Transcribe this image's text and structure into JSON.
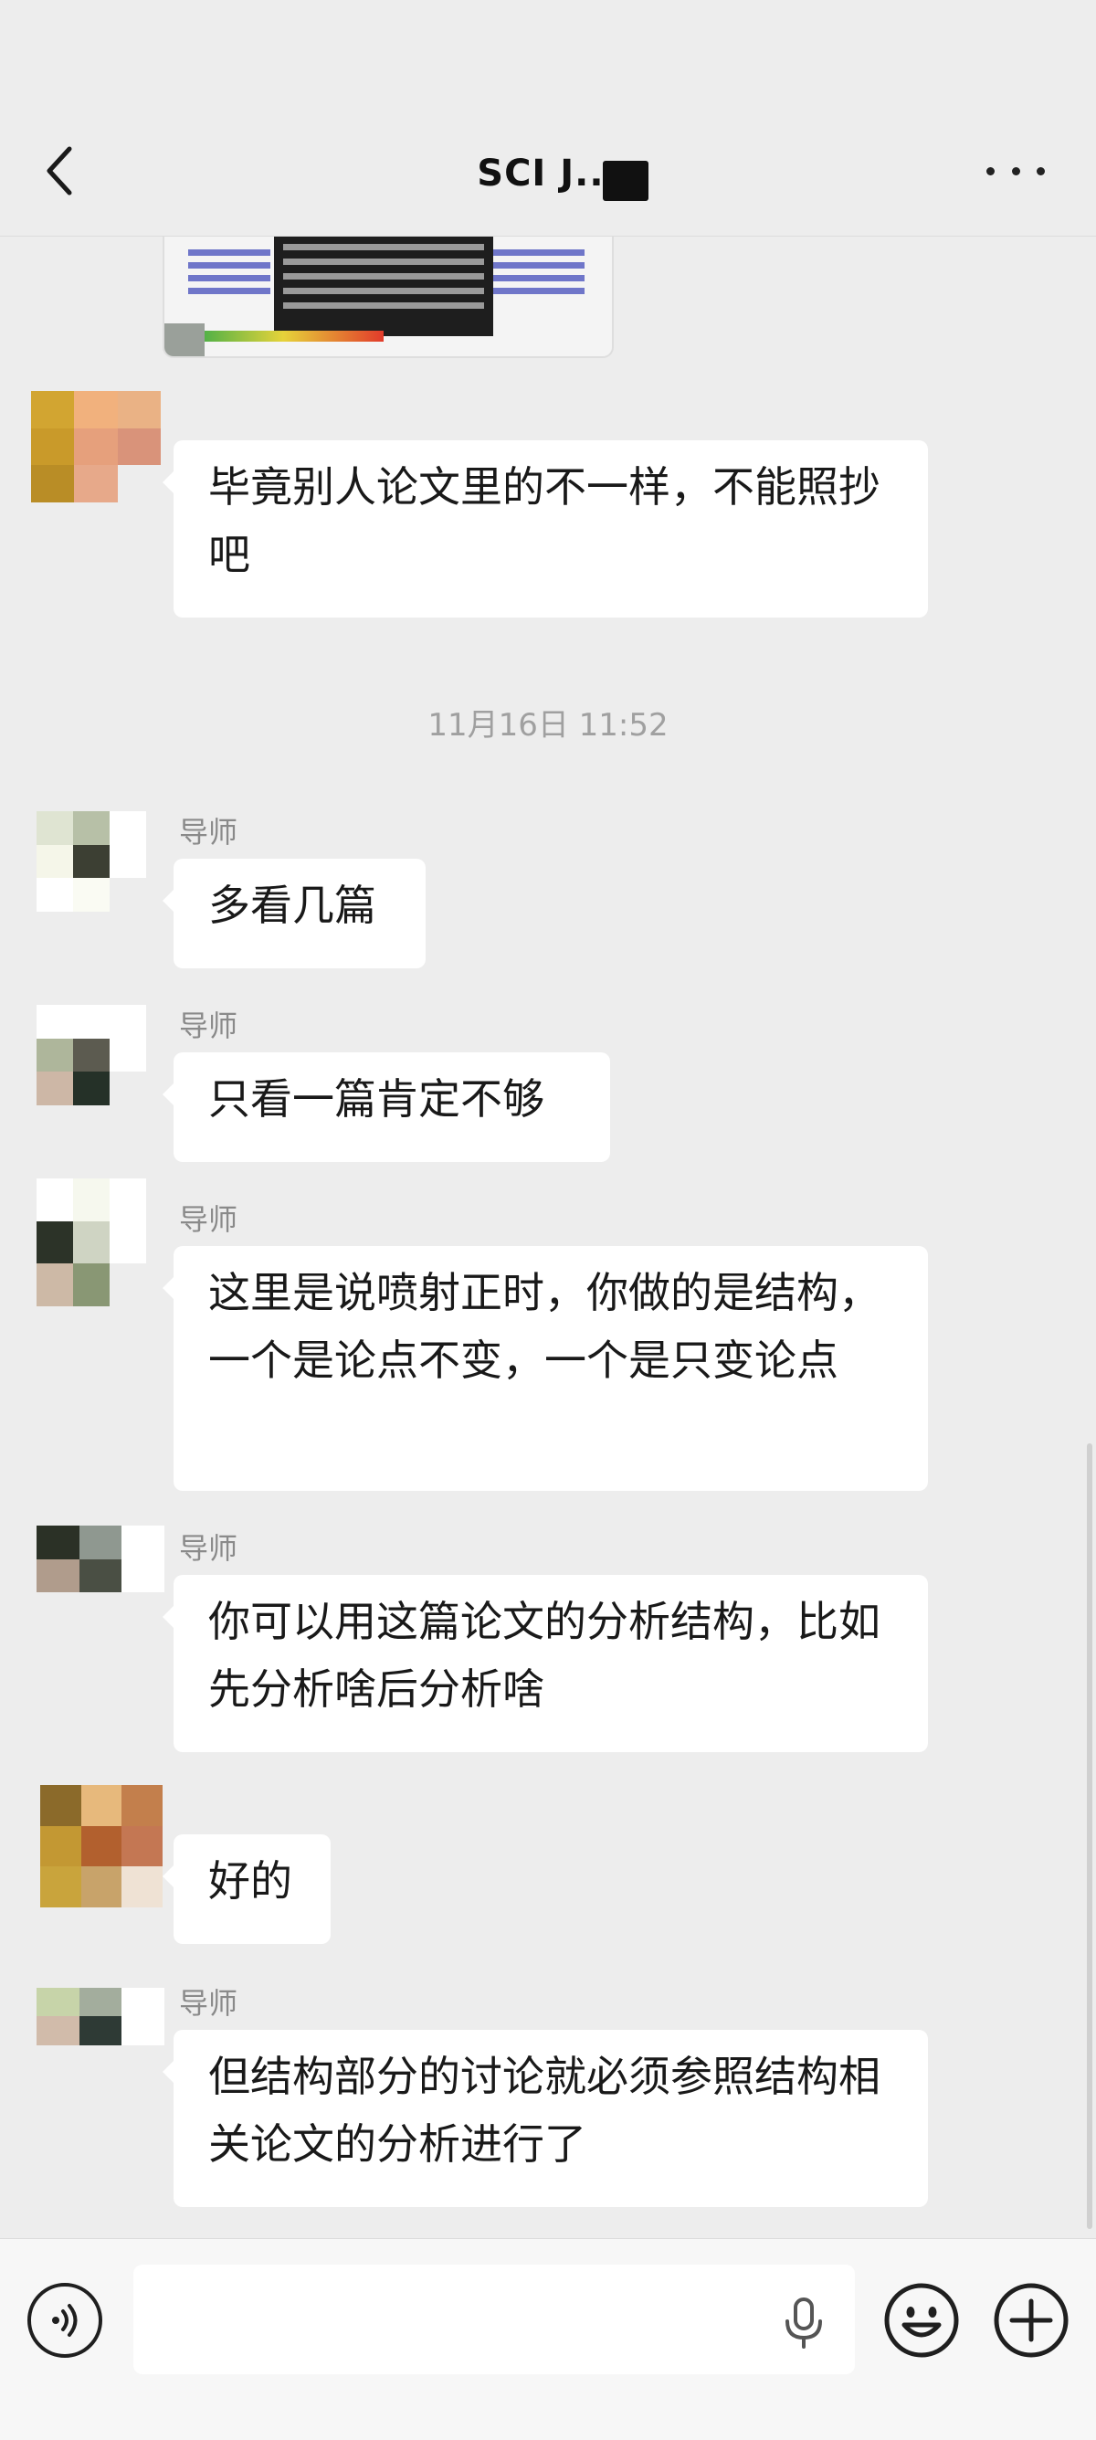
{
  "header": {
    "title": "SCI J...",
    "back_icon": "chevron-left-icon",
    "more_icon": "more-dots-icon"
  },
  "messages": [
    {
      "id": "m1",
      "sender": "",
      "text": "毕竟别人论文里的不一样，不能照抄吧"
    },
    {
      "id": "m2",
      "sender": "导师",
      "text": "多看几篇"
    },
    {
      "id": "m3",
      "sender": "导师",
      "text": "只看一篇肯定不够"
    },
    {
      "id": "m4",
      "sender": "导师",
      "text": "这里是说喷射正时，你做的是结构，一个是论点不变，一个是只变论点"
    },
    {
      "id": "m5",
      "sender": "导师",
      "text": "你可以用这篇论文的分析结构，比如先分析啥后分析啥"
    },
    {
      "id": "m6",
      "sender": "",
      "text": "好的"
    },
    {
      "id": "m7",
      "sender": "导师",
      "text": "但结构部分的讨论就必须参照结构相关论文的分析进行了"
    }
  ],
  "timestamp": "11月16日 11:52",
  "input": {
    "placeholder": "",
    "value": ""
  },
  "colors": {
    "background": "#ededed",
    "bubble": "#ffffff",
    "meta_text": "#8a8a8a"
  }
}
